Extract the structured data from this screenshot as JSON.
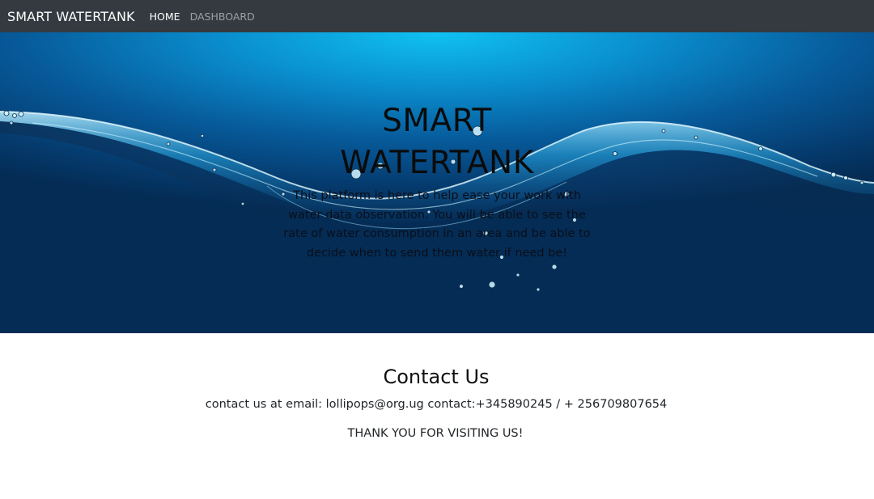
{
  "navbar": {
    "brand": "SMART WATERTANK",
    "links": [
      {
        "label": "HOME",
        "active": true
      },
      {
        "label": "DASHBOARD",
        "active": false
      }
    ]
  },
  "hero": {
    "title_line1": "SMART",
    "title_line2": "WATERTANK",
    "description": "This platform is here to help ease your work with water data observation. You will be able to see the rate of water consumption in an area and be able to decide when to send them water if need be!"
  },
  "contact": {
    "title": "Contact Us",
    "details": "contact us at email: lollipops@org.ug contact:+345890245 / + 256709807654",
    "thanks": "THANK YOU FOR VISITING US!"
  },
  "colors": {
    "navbar_bg": "#343a40",
    "hero_top": "#10c2f2",
    "hero_bottom": "#042c55"
  }
}
